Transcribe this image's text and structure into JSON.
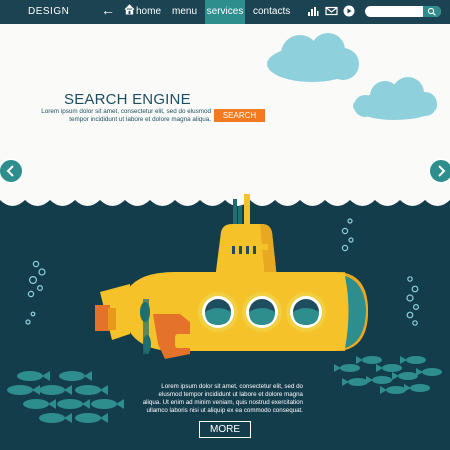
{
  "nav": {
    "brand": "DESIGN",
    "items": [
      "home",
      "menu",
      "services",
      "contacts"
    ],
    "active": "services"
  },
  "search": {
    "value": "",
    "placeholder": ""
  },
  "hero": {
    "title": "SEARCH ENGINE",
    "text": "Lorem ipsum dolor sit amet, consectetur elit, sed do elusmod tempor incididunt ut labore et dolore magna aliqua.",
    "button": "SEARCH"
  },
  "body": {
    "text": "Lorem ipsum dolor sit amet, consectetur elit, sed do elusmod tempor incididunt ut labore et dolore magna aliqua. Ut enim ad minim veniam, quis nostrud exercitation ullamco laboris nisi ut aliquip ex ea commodo consequat.",
    "button": "MORE"
  },
  "colors": {
    "nav_bg": "#1b4352",
    "accent": "#2e8d8d",
    "orange": "#f27b21",
    "sea": "#143d4c",
    "cloud": "#8fd0dd",
    "submarine": "#f6c22a"
  },
  "icons": [
    "back-arrow-icon",
    "home-icon",
    "chart-icon",
    "mail-icon",
    "play-icon",
    "search-icon",
    "chevron-left-icon",
    "chevron-right-icon"
  ]
}
